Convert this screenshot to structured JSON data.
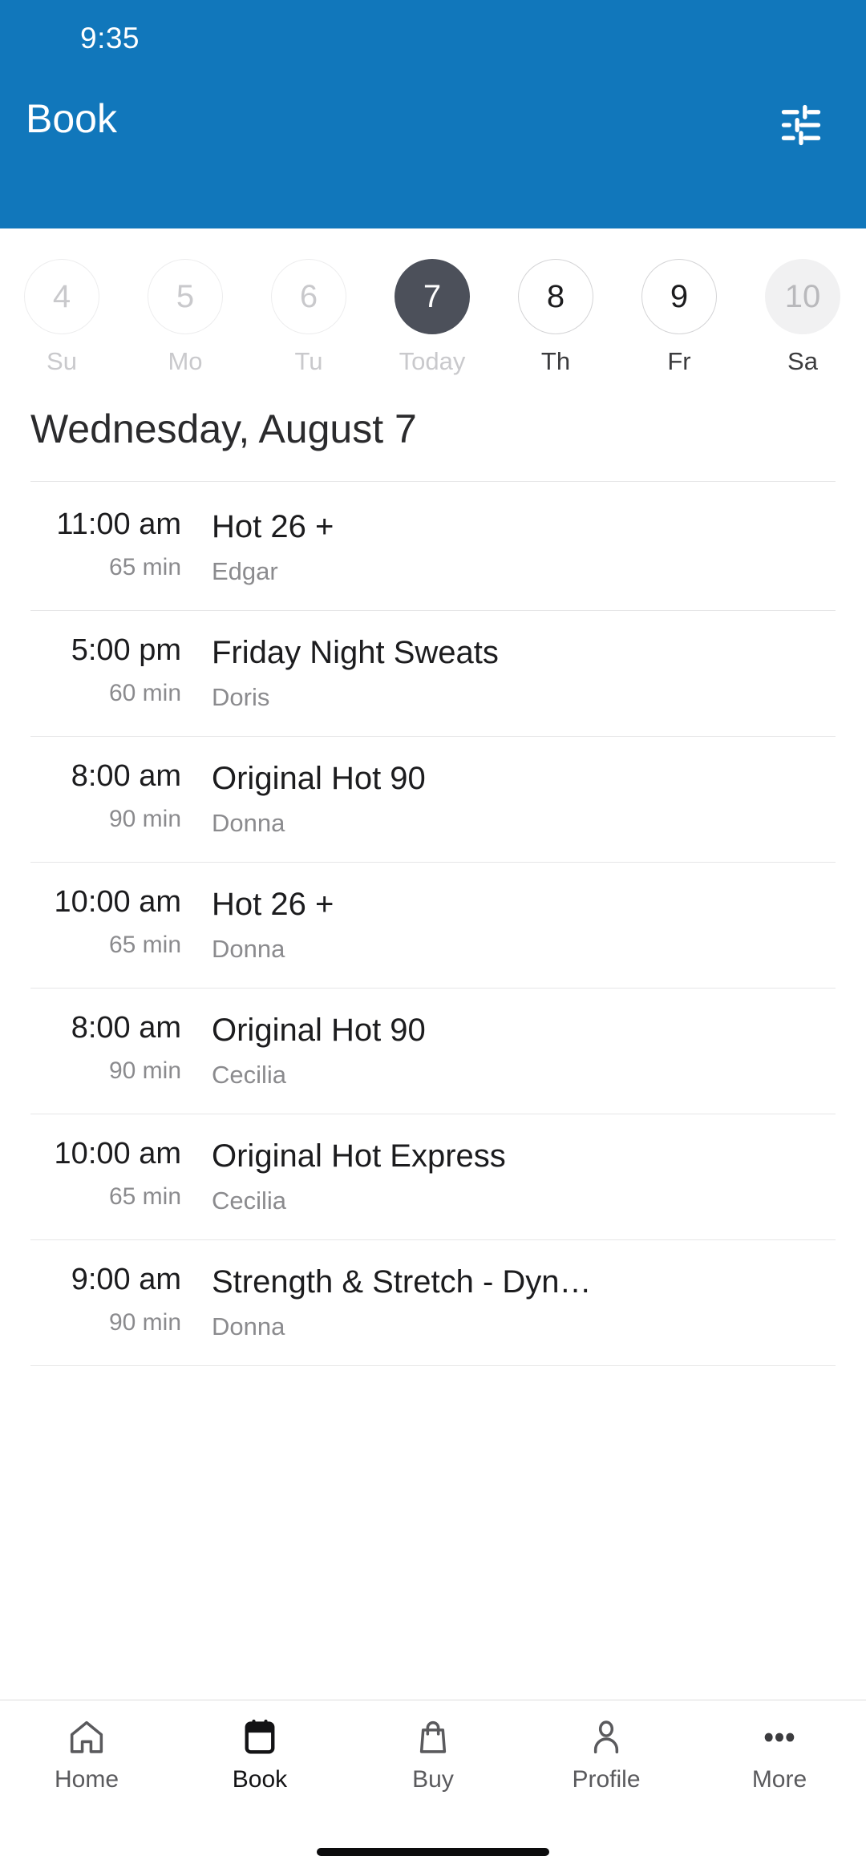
{
  "status_bar": {
    "time": "9:35"
  },
  "app_bar": {
    "title": "Book",
    "filter_icon": "tune-filter-icon",
    "background_color": "#1177bb"
  },
  "date_strip": {
    "days": [
      {
        "date": "4",
        "label": "Su",
        "state": "past"
      },
      {
        "date": "5",
        "label": "Mo",
        "state": "past"
      },
      {
        "date": "6",
        "label": "Tu",
        "state": "past"
      },
      {
        "date": "7",
        "label": "Today",
        "state": "selected"
      },
      {
        "date": "8",
        "label": "Th",
        "state": "available"
      },
      {
        "date": "9",
        "label": "Fr",
        "state": "available"
      },
      {
        "date": "10",
        "label": "Sa",
        "state": "muted"
      }
    ],
    "selected_color": "#4c505a"
  },
  "schedule": {
    "heading": "Wednesday, August 7",
    "classes": [
      {
        "time": "11:00 am",
        "duration": "65 min",
        "name": "Hot 26 +",
        "instructor": "Edgar"
      },
      {
        "time": "5:00 pm",
        "duration": "60 min",
        "name": "Friday Night Sweats",
        "instructor": "Doris"
      },
      {
        "time": "8:00 am",
        "duration": "90 min",
        "name": "Original Hot 90",
        "instructor": "Donna"
      },
      {
        "time": "10:00 am",
        "duration": "65 min",
        "name": "Hot 26 +",
        "instructor": "Donna"
      },
      {
        "time": "8:00 am",
        "duration": "90 min",
        "name": "Original Hot 90",
        "instructor": "Cecilia"
      },
      {
        "time": "10:00 am",
        "duration": "65 min",
        "name": "Original Hot Express",
        "instructor": "Cecilia"
      },
      {
        "time": "9:00 am",
        "duration": "90 min",
        "name": "Strength & Stretch - Dyn…",
        "instructor": "Donna"
      }
    ]
  },
  "bottom_nav": {
    "items": [
      {
        "label": "Home",
        "icon": "home-icon",
        "active": false
      },
      {
        "label": "Book",
        "icon": "calendar-icon",
        "active": true
      },
      {
        "label": "Buy",
        "icon": "bag-icon",
        "active": false
      },
      {
        "label": "Profile",
        "icon": "person-icon",
        "active": false
      },
      {
        "label": "More",
        "icon": "ellipsis-icon",
        "active": false
      }
    ]
  }
}
